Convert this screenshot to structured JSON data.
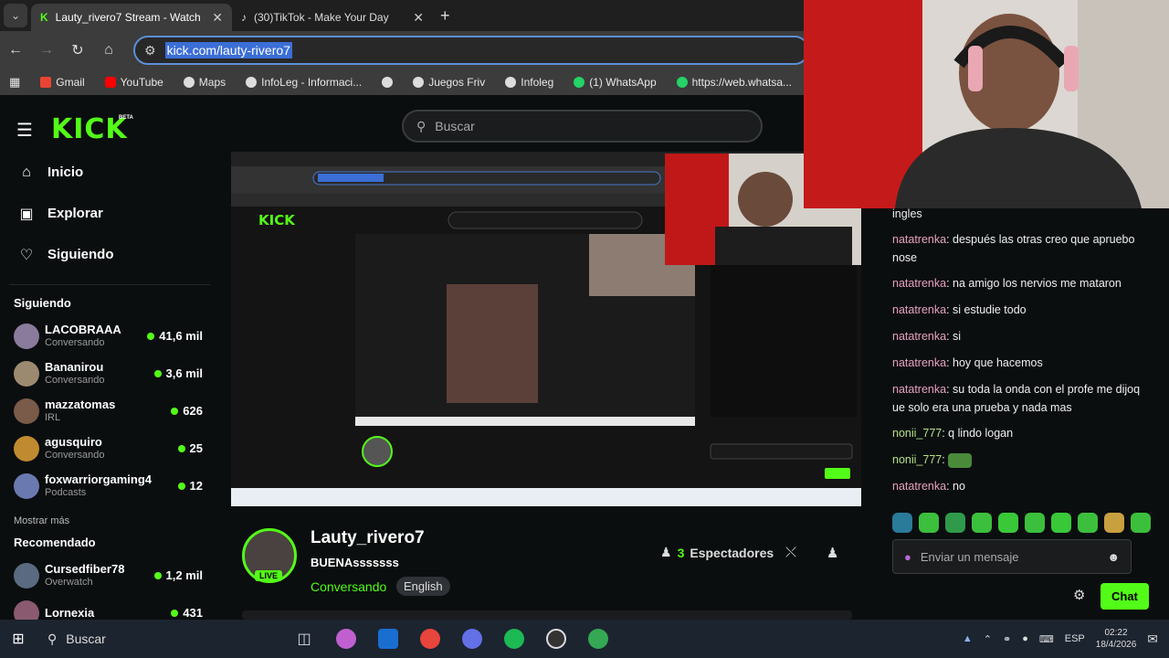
{
  "browser": {
    "tabs": [
      {
        "title": "Lauty_rivero7 Stream - Watch L",
        "icon": "kick-icon"
      },
      {
        "title": "(30)TikTok - Make Your Day",
        "icon": "tiktok-icon"
      }
    ],
    "url": "kick.com/lauty-rivero7",
    "bookmarks": [
      "Gmail",
      "YouTube",
      "Maps",
      "InfoLeg - Informaci...",
      "",
      "Juegos Friv",
      "Infoleg",
      "(1) WhatsApp",
      "https://web.whatsa..."
    ]
  },
  "header": {
    "logo": "KICK",
    "beta": "BETA",
    "search_placeholder": "Buscar"
  },
  "sidebar": {
    "nav": [
      {
        "label": "Inicio",
        "icon": "home-icon"
      },
      {
        "label": "Explorar",
        "icon": "compass-icon"
      },
      {
        "label": "Siguiendo",
        "icon": "heart-icon"
      }
    ],
    "following_title": "Siguiendo",
    "following": [
      {
        "name": "LACOBRAAA",
        "category": "Conversando",
        "viewers": "41,6 mil",
        "color": "#8a7a9c"
      },
      {
        "name": "Bananirou",
        "category": "Conversando",
        "viewers": "3,6 mil",
        "color": "#9c8a70"
      },
      {
        "name": "mazzatomas",
        "category": "IRL",
        "viewers": "626",
        "color": "#7a5a48"
      },
      {
        "name": "agusquiro",
        "category": "Conversando",
        "viewers": "25",
        "color": "#c08a30"
      },
      {
        "name": "foxwarriorgaming4",
        "category": "Podcasts",
        "viewers": "12",
        "color": "#6a7ab0"
      }
    ],
    "show_more": "Mostrar más",
    "recommended_title": "Recomendado",
    "recommended": [
      {
        "name": "Cursedfiber78",
        "category": "Overwatch",
        "viewers": "1,2 mil",
        "color": "#5a6a80"
      },
      {
        "name": "Lornexia",
        "category": "",
        "viewers": "431",
        "color": "#8a5a70"
      }
    ]
  },
  "stream": {
    "streamer": "Lauty_rivero7",
    "title": "BUENAsssssss",
    "category": "Conversando",
    "tag": "English",
    "live": "LIVE",
    "viewers_count": "3",
    "viewers_label": "Espectadores"
  },
  "chat": {
    "messages": [
      {
        "user": "",
        "text": "ingles"
      },
      {
        "user": "natatrenka",
        "text": ": después las otras creo que apruebo nose"
      },
      {
        "user": "natatrenka",
        "text": ": na amigo los nervios me mataron"
      },
      {
        "user": "natatrenka",
        "text": ": si estudie todo"
      },
      {
        "user": "natatrenka",
        "text": ": si"
      },
      {
        "user": "natatrenka",
        "text": ": hoy que hacemos"
      },
      {
        "user": "natatrenka",
        "text": ": su toda la onda con el profe me dijoq ue solo era una prueba y nada mas"
      },
      {
        "user": "nonii_777",
        "text": ": q lindo logan"
      },
      {
        "user": "nonii_777",
        "text": ":"
      },
      {
        "user": "natatrenka",
        "text": ": no"
      }
    ],
    "input_placeholder": "Enviar un mensaje",
    "send_label": "Chat"
  },
  "taskbar": {
    "search_label": "Buscar",
    "lang": "ESP",
    "time": "02:22",
    "date": "18/4/2026"
  }
}
